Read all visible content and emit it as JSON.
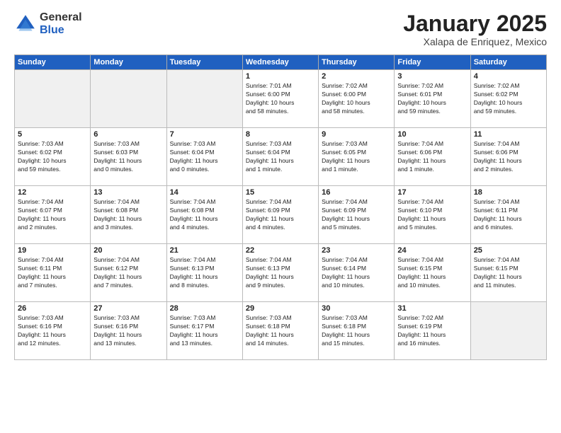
{
  "logo": {
    "general": "General",
    "blue": "Blue"
  },
  "header": {
    "month": "January 2025",
    "location": "Xalapa de Enriquez, Mexico"
  },
  "days": [
    "Sunday",
    "Monday",
    "Tuesday",
    "Wednesday",
    "Thursday",
    "Friday",
    "Saturday"
  ],
  "weeks": [
    [
      {
        "day": "",
        "text": ""
      },
      {
        "day": "",
        "text": ""
      },
      {
        "day": "",
        "text": ""
      },
      {
        "day": "1",
        "text": "Sunrise: 7:01 AM\nSunset: 6:00 PM\nDaylight: 10 hours\nand 58 minutes."
      },
      {
        "day": "2",
        "text": "Sunrise: 7:02 AM\nSunset: 6:00 PM\nDaylight: 10 hours\nand 58 minutes."
      },
      {
        "day": "3",
        "text": "Sunrise: 7:02 AM\nSunset: 6:01 PM\nDaylight: 10 hours\nand 59 minutes."
      },
      {
        "day": "4",
        "text": "Sunrise: 7:02 AM\nSunset: 6:02 PM\nDaylight: 10 hours\nand 59 minutes."
      }
    ],
    [
      {
        "day": "5",
        "text": "Sunrise: 7:03 AM\nSunset: 6:02 PM\nDaylight: 10 hours\nand 59 minutes."
      },
      {
        "day": "6",
        "text": "Sunrise: 7:03 AM\nSunset: 6:03 PM\nDaylight: 11 hours\nand 0 minutes."
      },
      {
        "day": "7",
        "text": "Sunrise: 7:03 AM\nSunset: 6:04 PM\nDaylight: 11 hours\nand 0 minutes."
      },
      {
        "day": "8",
        "text": "Sunrise: 7:03 AM\nSunset: 6:04 PM\nDaylight: 11 hours\nand 1 minute."
      },
      {
        "day": "9",
        "text": "Sunrise: 7:03 AM\nSunset: 6:05 PM\nDaylight: 11 hours\nand 1 minute."
      },
      {
        "day": "10",
        "text": "Sunrise: 7:04 AM\nSunset: 6:06 PM\nDaylight: 11 hours\nand 1 minute."
      },
      {
        "day": "11",
        "text": "Sunrise: 7:04 AM\nSunset: 6:06 PM\nDaylight: 11 hours\nand 2 minutes."
      }
    ],
    [
      {
        "day": "12",
        "text": "Sunrise: 7:04 AM\nSunset: 6:07 PM\nDaylight: 11 hours\nand 2 minutes."
      },
      {
        "day": "13",
        "text": "Sunrise: 7:04 AM\nSunset: 6:08 PM\nDaylight: 11 hours\nand 3 minutes."
      },
      {
        "day": "14",
        "text": "Sunrise: 7:04 AM\nSunset: 6:08 PM\nDaylight: 11 hours\nand 4 minutes."
      },
      {
        "day": "15",
        "text": "Sunrise: 7:04 AM\nSunset: 6:09 PM\nDaylight: 11 hours\nand 4 minutes."
      },
      {
        "day": "16",
        "text": "Sunrise: 7:04 AM\nSunset: 6:09 PM\nDaylight: 11 hours\nand 5 minutes."
      },
      {
        "day": "17",
        "text": "Sunrise: 7:04 AM\nSunset: 6:10 PM\nDaylight: 11 hours\nand 5 minutes."
      },
      {
        "day": "18",
        "text": "Sunrise: 7:04 AM\nSunset: 6:11 PM\nDaylight: 11 hours\nand 6 minutes."
      }
    ],
    [
      {
        "day": "19",
        "text": "Sunrise: 7:04 AM\nSunset: 6:11 PM\nDaylight: 11 hours\nand 7 minutes."
      },
      {
        "day": "20",
        "text": "Sunrise: 7:04 AM\nSunset: 6:12 PM\nDaylight: 11 hours\nand 7 minutes."
      },
      {
        "day": "21",
        "text": "Sunrise: 7:04 AM\nSunset: 6:13 PM\nDaylight: 11 hours\nand 8 minutes."
      },
      {
        "day": "22",
        "text": "Sunrise: 7:04 AM\nSunset: 6:13 PM\nDaylight: 11 hours\nand 9 minutes."
      },
      {
        "day": "23",
        "text": "Sunrise: 7:04 AM\nSunset: 6:14 PM\nDaylight: 11 hours\nand 10 minutes."
      },
      {
        "day": "24",
        "text": "Sunrise: 7:04 AM\nSunset: 6:15 PM\nDaylight: 11 hours\nand 10 minutes."
      },
      {
        "day": "25",
        "text": "Sunrise: 7:04 AM\nSunset: 6:15 PM\nDaylight: 11 hours\nand 11 minutes."
      }
    ],
    [
      {
        "day": "26",
        "text": "Sunrise: 7:03 AM\nSunset: 6:16 PM\nDaylight: 11 hours\nand 12 minutes."
      },
      {
        "day": "27",
        "text": "Sunrise: 7:03 AM\nSunset: 6:16 PM\nDaylight: 11 hours\nand 13 minutes."
      },
      {
        "day": "28",
        "text": "Sunrise: 7:03 AM\nSunset: 6:17 PM\nDaylight: 11 hours\nand 13 minutes."
      },
      {
        "day": "29",
        "text": "Sunrise: 7:03 AM\nSunset: 6:18 PM\nDaylight: 11 hours\nand 14 minutes."
      },
      {
        "day": "30",
        "text": "Sunrise: 7:03 AM\nSunset: 6:18 PM\nDaylight: 11 hours\nand 15 minutes."
      },
      {
        "day": "31",
        "text": "Sunrise: 7:02 AM\nSunset: 6:19 PM\nDaylight: 11 hours\nand 16 minutes."
      },
      {
        "day": "",
        "text": ""
      }
    ]
  ]
}
